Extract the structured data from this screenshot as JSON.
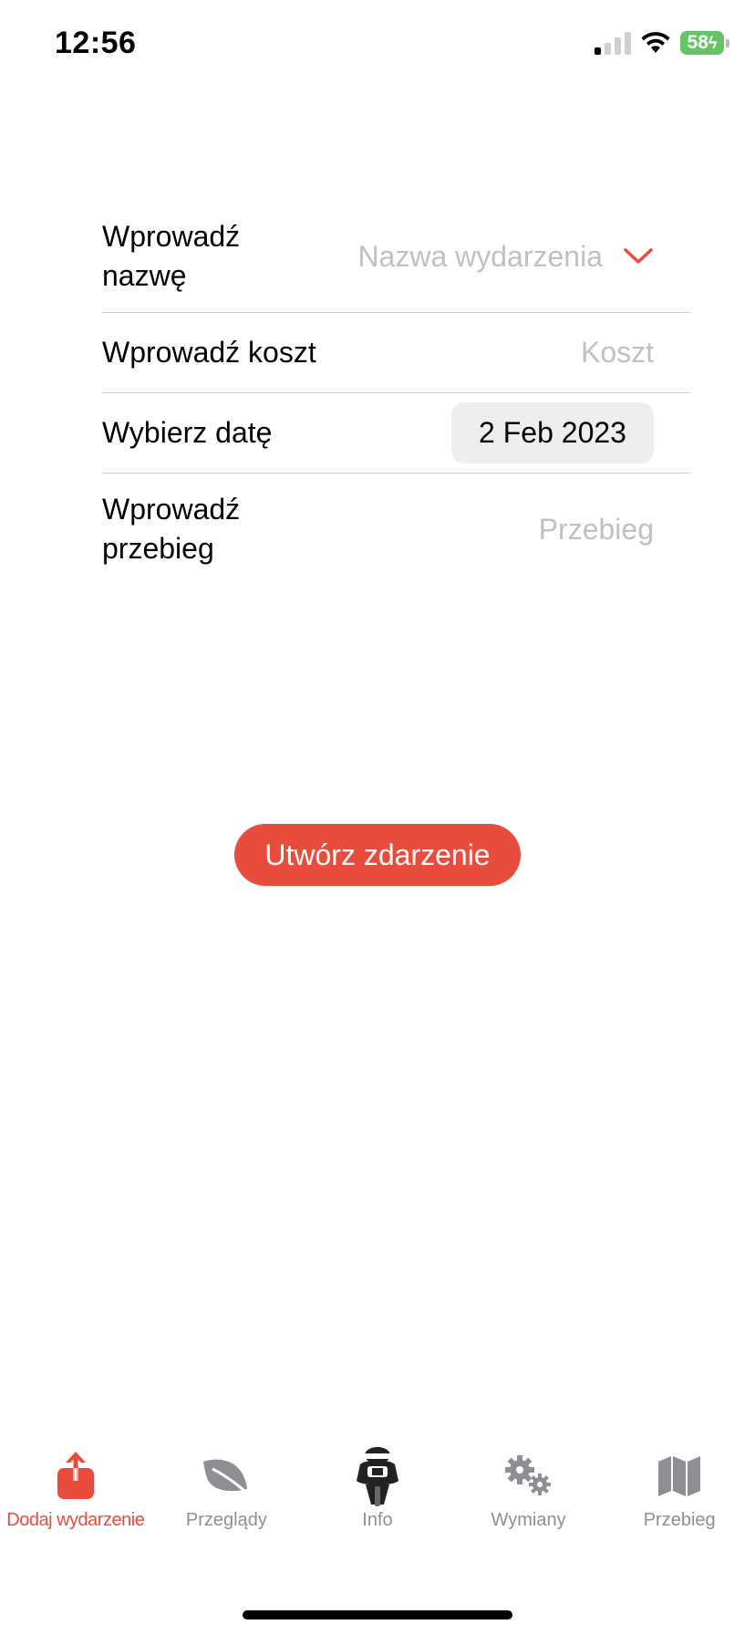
{
  "status_bar": {
    "time": "12:56",
    "battery": "58"
  },
  "form": {
    "name_label": "Wprowadź nazwę",
    "name_placeholder": "Nazwa wydarzenia",
    "cost_label": "Wprowadź koszt",
    "cost_placeholder": "Koszt",
    "date_label": "Wybierz datę",
    "date_value": "2 Feb 2023",
    "mileage_label": "Wprowadź przebieg",
    "mileage_placeholder": "Przebieg"
  },
  "create_button": "Utwórz zdarzenie",
  "tabs": [
    {
      "label": "Dodaj wydarzenie",
      "icon": "share-upload-icon",
      "active": true
    },
    {
      "label": "Przeglądy",
      "icon": "leaf-icon",
      "active": false
    },
    {
      "label": "Info",
      "icon": "motorcycle-rider-icon",
      "active": false
    },
    {
      "label": "Wymiany",
      "icon": "gears-icon",
      "active": false
    },
    {
      "label": "Przebieg",
      "icon": "map-icon",
      "active": false
    }
  ],
  "colors": {
    "accent": "#e74c3c",
    "inactive": "#8e8e93",
    "placeholder": "#c0c0c0",
    "battery": "#64c466"
  }
}
